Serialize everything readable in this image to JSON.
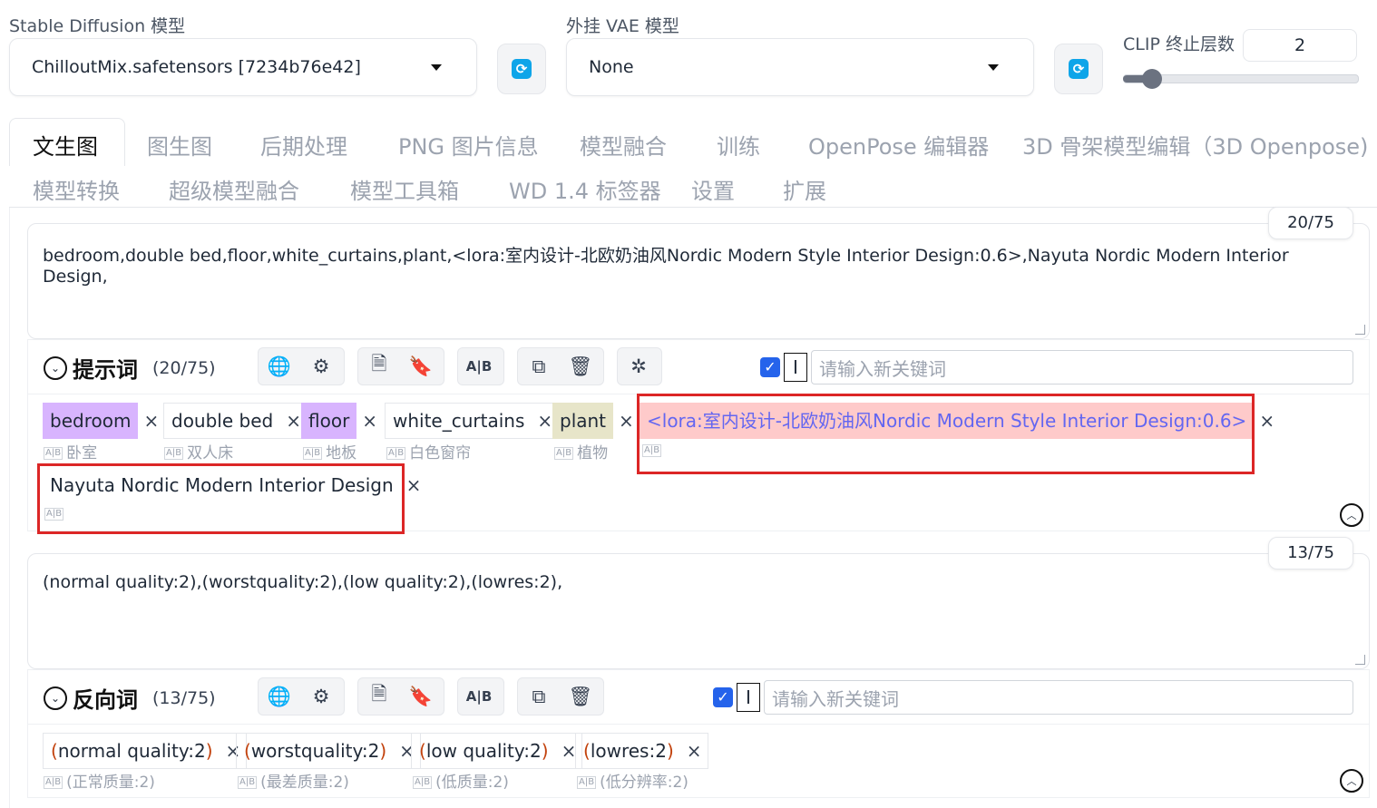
{
  "model": {
    "label": "Stable Diffusion 模型",
    "value": "ChilloutMix.safetensors [7234b76e42]"
  },
  "vae": {
    "label": "外挂 VAE 模型",
    "value": "None"
  },
  "clip": {
    "label": "CLIP 终止层数",
    "value": "2",
    "level": 0.08
  },
  "tabs_row1": [
    "文生图",
    "图生图",
    "后期处理",
    "PNG 图片信息",
    "模型融合",
    "训练",
    "OpenPose 编辑器",
    "3D 骨架模型编辑（3D Openpose)"
  ],
  "tabs_row2": [
    "模型转换",
    "超级模型融合",
    "模型工具箱",
    "WD 1.4 标签器",
    "设置",
    "扩展"
  ],
  "prompt": {
    "text": "bedroom,double bed,floor,white_curtains,plant,<lora:室内设计-北欧奶油风Nordic Modern Style Interior Design:0.6>,Nayuta Nordic Modern Interior Design,",
    "counter": "20/75",
    "title": "提示词",
    "count": "(20/75)",
    "keyword_placeholder": "请输入新关键词",
    "tags": [
      {
        "text": "bedroom",
        "translation": "卧室",
        "color": "#d8b4fe"
      },
      {
        "text": "double bed",
        "translation": "双人床",
        "color": "#ffffff"
      },
      {
        "text": "floor",
        "translation": "地板",
        "color": "#d8b4fe"
      },
      {
        "text": "white_curtains",
        "translation": "白色窗帘",
        "color": "#ffffff"
      },
      {
        "text": "plant",
        "translation": "植物",
        "color": "#e7e5c9"
      },
      {
        "text": "<lora:室内设计-北欧奶油风Nordic Modern Style Interior Design:0.6>",
        "translation": "",
        "color": "#fecaca"
      },
      {
        "text": "Nayuta Nordic Modern Interior Design",
        "translation": "",
        "color": "#ffffff"
      }
    ]
  },
  "negative": {
    "text": "(normal quality:2),(worstquality:2),(low quality:2),(lowres:2),",
    "counter": "13/75",
    "title": "反向词",
    "count": "(13/75)",
    "keyword_placeholder": "请输入新关键词",
    "tags": [
      {
        "open": "(",
        "inner": "normal quality:2",
        "close": ")",
        "translation": "(正常质量:2)"
      },
      {
        "open": "(",
        "inner": "worstquality:2",
        "close": ")",
        "translation": "(最差质量:2)"
      },
      {
        "open": "(",
        "inner": "low quality:2",
        "close": ")",
        "translation": "(低质量:2)"
      },
      {
        "open": "(",
        "inner": "lowres:2",
        "close": ")",
        "translation": "(低分辨率:2)"
      }
    ]
  },
  "close_glyph": "×",
  "colors": {
    "accent": "#0ea5e9",
    "highlight": "#dc2626",
    "lora_text": "#6366f1",
    "paren": "#c2410c"
  }
}
